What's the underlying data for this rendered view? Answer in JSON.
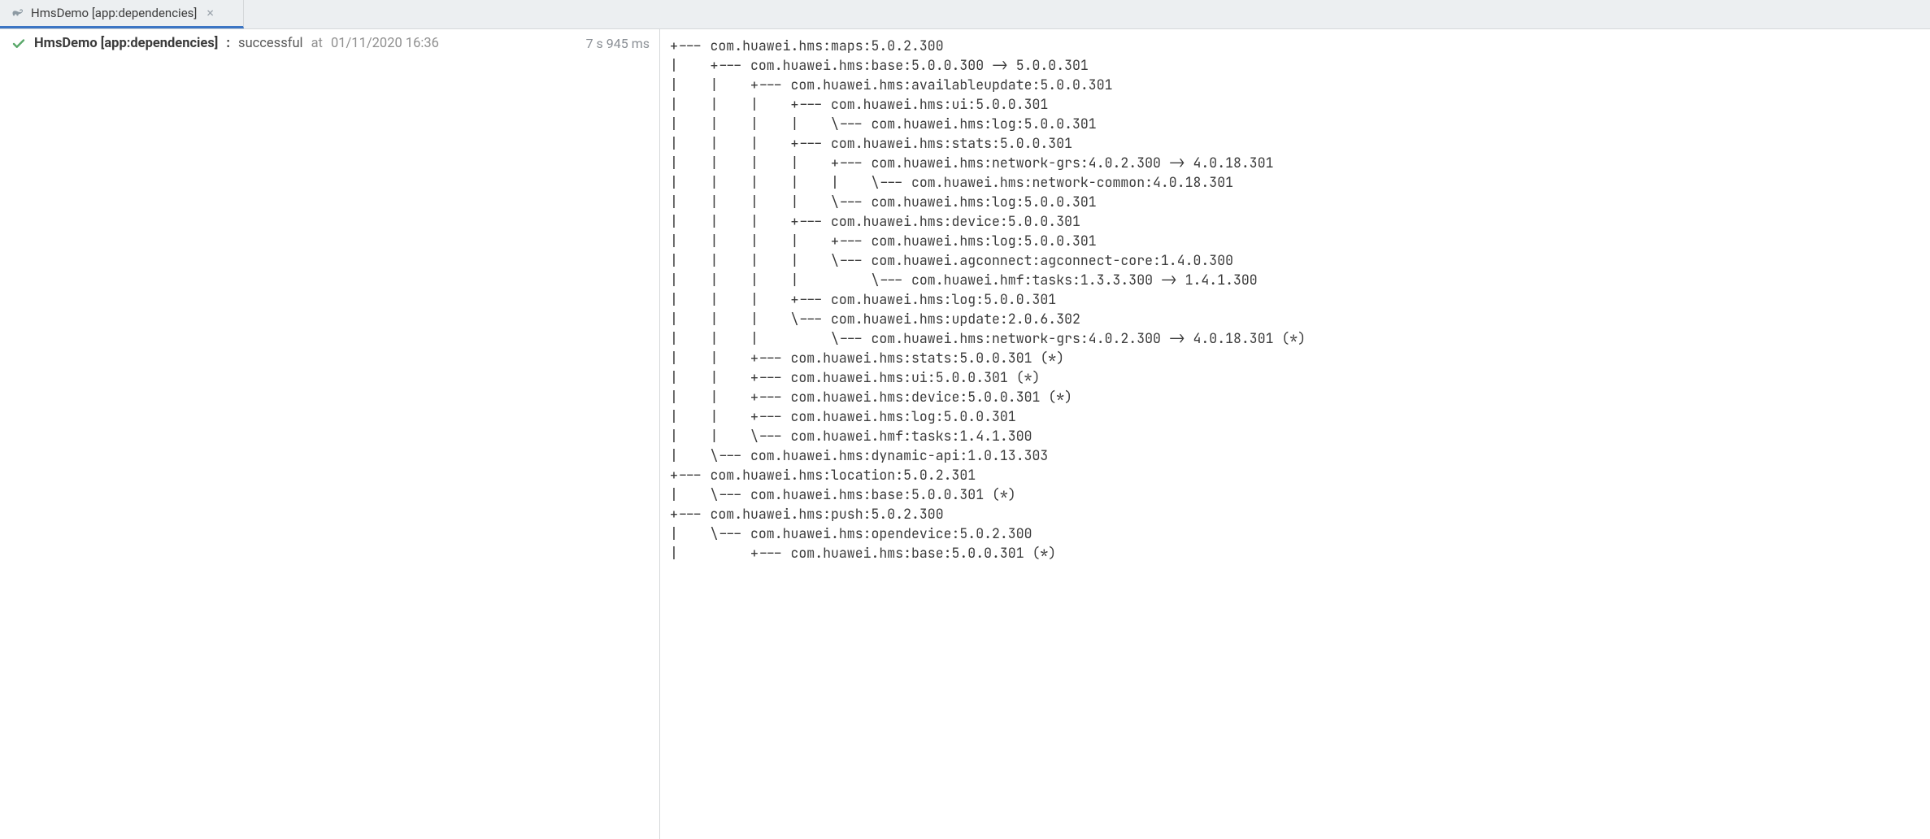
{
  "tab": {
    "label": "HmsDemo [app:dependencies]"
  },
  "task": {
    "title": "HmsDemo [app:dependencies]",
    "separator": ":",
    "status": "successful",
    "at_word": "at",
    "timestamp": "01/11/2020 16:36",
    "duration": "7 s 945 ms"
  },
  "tree_lines": [
    "+--- com.huawei.hms:maps:5.0.2.300",
    "|    +--- com.huawei.hms:base:5.0.0.300 -> 5.0.0.301",
    "|    |    +--- com.huawei.hms:availableupdate:5.0.0.301",
    "|    |    |    +--- com.huawei.hms:ui:5.0.0.301",
    "|    |    |    |    \\--- com.huawei.hms:log:5.0.0.301",
    "|    |    |    +--- com.huawei.hms:stats:5.0.0.301",
    "|    |    |    |    +--- com.huawei.hms:network-grs:4.0.2.300 -> 4.0.18.301",
    "|    |    |    |    |    \\--- com.huawei.hms:network-common:4.0.18.301",
    "|    |    |    |    \\--- com.huawei.hms:log:5.0.0.301",
    "|    |    |    +--- com.huawei.hms:device:5.0.0.301",
    "|    |    |    |    +--- com.huawei.hms:log:5.0.0.301",
    "|    |    |    |    \\--- com.huawei.agconnect:agconnect-core:1.4.0.300",
    "|    |    |    |         \\--- com.huawei.hmf:tasks:1.3.3.300 -> 1.4.1.300",
    "|    |    |    +--- com.huawei.hms:log:5.0.0.301",
    "|    |    |    \\--- com.huawei.hms:update:2.0.6.302",
    "|    |    |         \\--- com.huawei.hms:network-grs:4.0.2.300 -> 4.0.18.301 (*)",
    "|    |    +--- com.huawei.hms:stats:5.0.0.301 (*)",
    "|    |    +--- com.huawei.hms:ui:5.0.0.301 (*)",
    "|    |    +--- com.huawei.hms:device:5.0.0.301 (*)",
    "|    |    +--- com.huawei.hms:log:5.0.0.301",
    "|    |    \\--- com.huawei.hmf:tasks:1.4.1.300",
    "|    \\--- com.huawei.hms:dynamic-api:1.0.13.303",
    "+--- com.huawei.hms:location:5.0.2.301",
    "|    \\--- com.huawei.hms:base:5.0.0.301 (*)",
    "+--- com.huawei.hms:push:5.0.2.300",
    "|    \\--- com.huawei.hms:opendevice:5.0.2.300",
    "|         +--- com.huawei.hms:base:5.0.0.301 (*)"
  ]
}
